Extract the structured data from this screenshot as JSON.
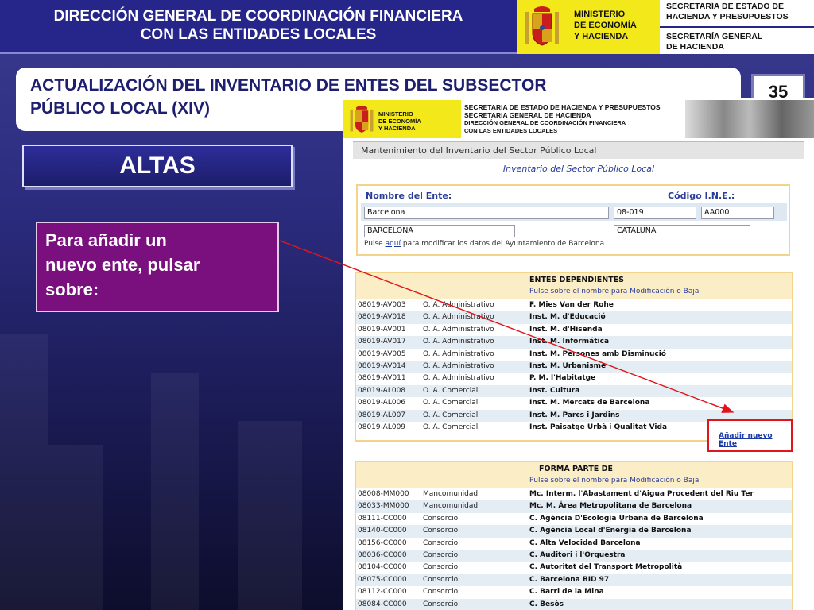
{
  "header": {
    "title_line1": "DIRECCIÓN GENERAL DE COORDINACIÓN FINANCIERA",
    "title_line2": "CON LAS ENTIDADES LOCALES",
    "ministry_line1": "MINISTERIO",
    "ministry_line2": "DE ECONOMÍA",
    "ministry_line3": "Y HACIENDA",
    "secretaria1_line1": "SECRETARÍA DE ESTADO DE",
    "secretaria1_line2": "HACIENDA Y PRESUPUESTOS",
    "secretaria2_line1": "SECRETARÍA GENERAL",
    "secretaria2_line2": "DE HACIENDA",
    "accent_color": "#26268a",
    "logo_color": "#f3e81a"
  },
  "slide": {
    "title_line1": "ACTUALIZACIÓN DEL INVENTARIO DE ENTES DEL SUBSECTOR",
    "title_line2": "PÚBLICO LOCAL (XIV)",
    "number": "35",
    "section_label": "ALTAS",
    "note_line1": "Para añadir un",
    "note_line2": "nuevo ente, pulsar",
    "note_line3": "sobre:",
    "note_color": "#7a0f7e"
  },
  "app": {
    "ministry_line1": "MINISTERIO",
    "ministry_line2": "DE ECONOMÍA",
    "ministry_line3": "Y HACIENDA",
    "sec_line1": "SECRETARIA DE ESTADO DE HACIENDA Y PRESUPUESTOS",
    "sec_line2": "SECRETARIA GENERAL DE HACIENDA",
    "sec_line3": "DIRECCIÓN GENERAL DE COORDINACIÓN FINANCIERA",
    "sec_line4": "CON LAS ENTIDADES LOCALES",
    "menu_title": "Mantenimiento del Inventario del Sector Público Local",
    "subtitle": "Inventario del Sector Público Local",
    "form": {
      "name_label": "Nombre del Ente:",
      "ine_label": "Código I.N.E.:",
      "name_value": "Barcelona",
      "code_value": "08-019",
      "code2_value": "AA000",
      "province_value": "BARCELONA",
      "region_value": "CATALUÑA",
      "edit_prefix": "Pulse",
      "edit_link": "aquí",
      "edit_suffix": "para modificar los datos del Ayuntamiento de Barcelona"
    },
    "dependientes": {
      "title": "ENTES DEPENDIENTES",
      "hint": "Pulse sobre el nombre para Modificación o Baja",
      "rows": [
        {
          "code": "08019-AV003",
          "type": "O. A. Administrativo",
          "name": "F. Mies Van der Rohe"
        },
        {
          "code": "08019-AV018",
          "type": "O. A. Administrativo",
          "name": "Inst. M. d'Educació"
        },
        {
          "code": "08019-AV001",
          "type": "O. A. Administrativo",
          "name": "Inst. M. d'Hisenda"
        },
        {
          "code": "08019-AV017",
          "type": "O. A. Administrativo",
          "name": "Inst. M. Informática"
        },
        {
          "code": "08019-AV005",
          "type": "O. A. Administrativo",
          "name": "Inst. M. Persones amb Disminució"
        },
        {
          "code": "08019-AV014",
          "type": "O. A. Administrativo",
          "name": "Inst. M. Urbanisme"
        },
        {
          "code": "08019-AV011",
          "type": "O. A. Administrativo",
          "name": "P. M. l'Habitatge"
        },
        {
          "code": "08019-AL008",
          "type": "O. A. Comercial",
          "name": "Inst. Cultura"
        },
        {
          "code": "08019-AL006",
          "type": "O. A. Comercial",
          "name": "Inst. M. Mercats de Barcelona"
        },
        {
          "code": "08019-AL007",
          "type": "O. A. Comercial",
          "name": "Inst. M. Parcs i Jardins"
        },
        {
          "code": "08019-AL009",
          "type": "O. A. Comercial",
          "name": "Inst. Paisatge Urbà i Qualitat Vida"
        }
      ],
      "add_link": "Añadir nuevo Ente"
    },
    "forma_parte": {
      "title": "FORMA PARTE DE",
      "hint": "Pulse sobre el nombre para Modificación o Baja",
      "rows": [
        {
          "code": "08008-MM000",
          "type": "Mancomunidad",
          "name": "Mc. Interm. l'Abastament d'Aigua Procedent del Riu Ter"
        },
        {
          "code": "08033-MM000",
          "type": "Mancomunidad",
          "name": "Mc. M. Área Metropolitana de Barcelona"
        },
        {
          "code": "08111-CC000",
          "type": "Consorcio",
          "name": "C. Agència D'Ecologia Urbana de Barcelona"
        },
        {
          "code": "08140-CC000",
          "type": "Consorcio",
          "name": "C. Agència Local d'Energia de Barcelona"
        },
        {
          "code": "08156-CC000",
          "type": "Consorcio",
          "name": "C. Alta Velocidad Barcelona"
        },
        {
          "code": "08036-CC000",
          "type": "Consorcio",
          "name": "C. Auditori i l'Orquestra"
        },
        {
          "code": "08104-CC000",
          "type": "Consorcio",
          "name": "C. Autoritat del Transport Metropolità"
        },
        {
          "code": "08075-CC000",
          "type": "Consorcio",
          "name": "C. Barcelona BID 97"
        },
        {
          "code": "08112-CC000",
          "type": "Consorcio",
          "name": "C. Barri de la Mina"
        },
        {
          "code": "08084-CC000",
          "type": "Consorcio",
          "name": "C. Besòs"
        }
      ]
    }
  }
}
